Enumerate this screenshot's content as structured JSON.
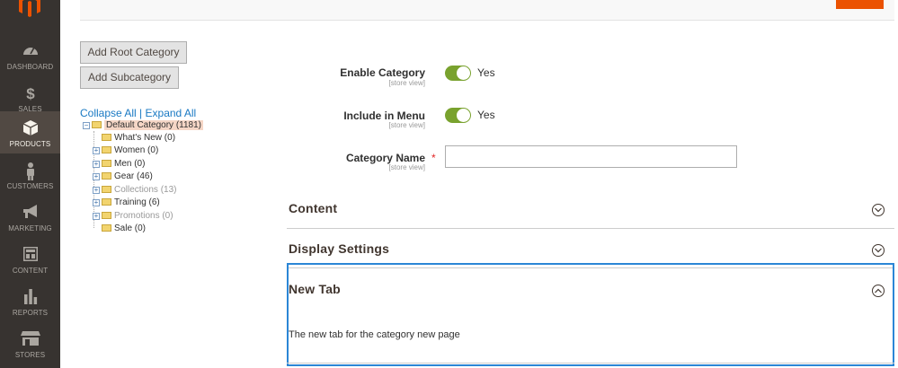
{
  "sidebar": {
    "items": [
      {
        "label": "DASHBOARD",
        "icon": "dashboard-icon"
      },
      {
        "label": "SALES",
        "icon": "dollar-icon"
      },
      {
        "label": "PRODUCTS",
        "icon": "box-icon",
        "active": true
      },
      {
        "label": "CUSTOMERS",
        "icon": "person-icon"
      },
      {
        "label": "MARKETING",
        "icon": "megaphone-icon"
      },
      {
        "label": "CONTENT",
        "icon": "layout-icon"
      },
      {
        "label": "REPORTS",
        "icon": "bar-chart-icon"
      },
      {
        "label": "STORES",
        "icon": "storefront-icon"
      }
    ]
  },
  "buttons": {
    "add_root": "Add Root Category",
    "add_sub": "Add Subcategory"
  },
  "tree": {
    "collapse_all": "Collapse All",
    "separator": "|",
    "expand_all": "Expand All",
    "root": "Default Category (1181)",
    "children": [
      "What's New (0)",
      "Women (0)",
      "Men (0)",
      "Gear (46)",
      "Collections (13)",
      "Training (6)",
      "Promotions (0)",
      "Sale (0)"
    ]
  },
  "form": {
    "enable_label": "Enable Category",
    "enable_scope": "[store view]",
    "enable_value": "Yes",
    "menu_label": "Include in Menu",
    "menu_scope": "[store view]",
    "menu_value": "Yes",
    "name_label": "Category Name",
    "name_scope": "[store view]",
    "required_mark": "*",
    "name_value": ""
  },
  "sections": {
    "content": "Content",
    "display": "Display Settings",
    "new_tab": "New Tab",
    "new_tab_text": "The new tab for the category new page"
  },
  "colors": {
    "sidebar_bg": "#373330",
    "sidebar_active": "#514943",
    "accent": "#eb5202",
    "toggle_on": "#79a22e",
    "link": "#1979c3",
    "focus_border": "#2b86d6"
  }
}
